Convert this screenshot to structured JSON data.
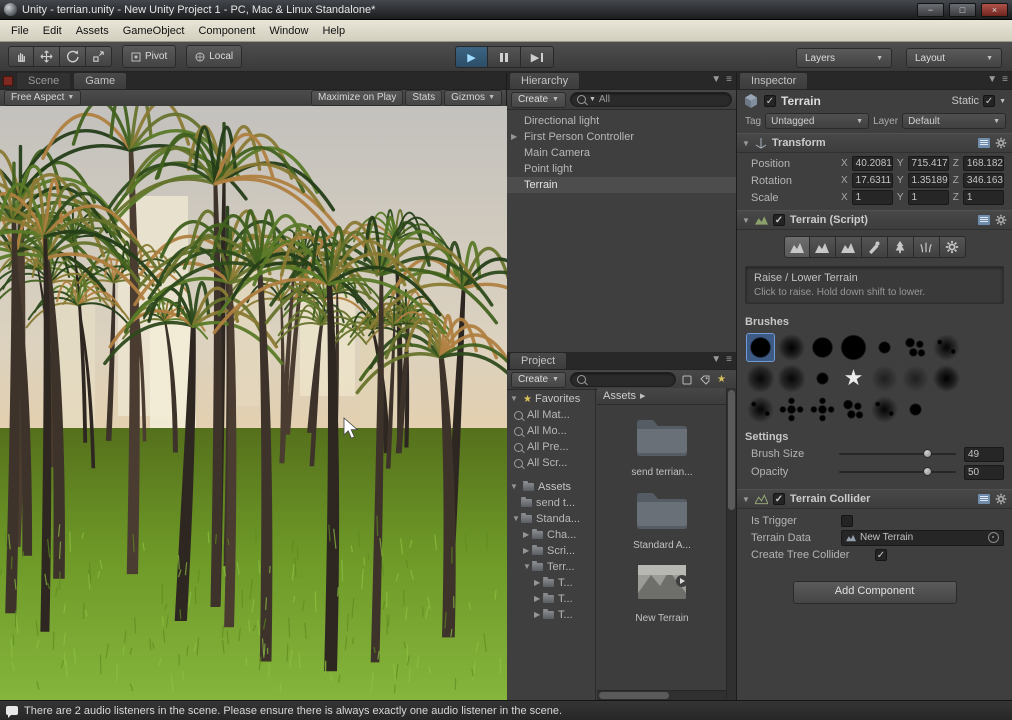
{
  "window": {
    "title": "Unity - terrian.unity - New Unity Project 1 - PC, Mac & Linux Standalone*",
    "minimize": "−",
    "maximize": "□",
    "close": "×"
  },
  "menubar": {
    "items": [
      "File",
      "Edit",
      "Assets",
      "GameObject",
      "Component",
      "Window",
      "Help"
    ]
  },
  "toolbar": {
    "pivot": "Pivot",
    "local": "Local",
    "layers": "Layers",
    "layout": "Layout"
  },
  "game_panel": {
    "scene_tab": "Scene",
    "game_tab": "Game",
    "aspect": "Free Aspect",
    "maximize_on_play": "Maximize on Play",
    "stats": "Stats",
    "gizmos": "Gizmos"
  },
  "hierarchy": {
    "tab": "Hierarchy",
    "create": "Create",
    "search_filter": "All",
    "items": [
      {
        "label": "Directional light",
        "foldable": false,
        "selected": false
      },
      {
        "label": "First Person Controller",
        "foldable": true,
        "selected": false
      },
      {
        "label": "Main Camera",
        "foldable": false,
        "selected": false
      },
      {
        "label": "Point light",
        "foldable": false,
        "selected": false
      },
      {
        "label": "Terrain",
        "foldable": false,
        "selected": true
      }
    ]
  },
  "project": {
    "tab": "Project",
    "create": "Create",
    "favorites_label": "Favorites",
    "favorites": [
      {
        "label": "All Mat..."
      },
      {
        "label": "All Mo..."
      },
      {
        "label": "All Pre..."
      },
      {
        "label": "All Scr..."
      }
    ],
    "assets_label": "Assets",
    "tree": [
      {
        "label": "send t...",
        "indent": 0,
        "fold": "none"
      },
      {
        "label": "Standa...",
        "indent": 0,
        "fold": "open"
      },
      {
        "label": "Cha...",
        "indent": 1,
        "fold": "closed"
      },
      {
        "label": "Scri...",
        "indent": 1,
        "fold": "closed"
      },
      {
        "label": "Terr...",
        "indent": 1,
        "fold": "open"
      },
      {
        "label": "T...",
        "indent": 2,
        "fold": "closed"
      },
      {
        "label": "T...",
        "indent": 2,
        "fold": "closed"
      },
      {
        "label": "T...",
        "indent": 2,
        "fold": "closed"
      }
    ],
    "breadcrumb": "Assets",
    "thumbnails": [
      {
        "label": "send terrian...",
        "kind": "folder"
      },
      {
        "label": "Standard A...",
        "kind": "folder"
      },
      {
        "label": "New Terrain",
        "kind": "terrain"
      }
    ]
  },
  "inspector": {
    "tab": "Inspector",
    "object_name": "Terrain",
    "static_label": "Static",
    "tag_label": "Tag",
    "tag_value": "Untagged",
    "layer_label": "Layer",
    "layer_value": "Default",
    "transform": {
      "title": "Transform",
      "rows": [
        {
          "label": "Position",
          "x": "40.2081",
          "y": "715.417",
          "z": "168.182"
        },
        {
          "label": "Rotation",
          "x": "17.6311",
          "y": "1.35189",
          "z": "346.163"
        },
        {
          "label": "Scale",
          "x": "1",
          "y": "1",
          "z": "1"
        }
      ]
    },
    "terrain_script": {
      "title": "Terrain (Script)",
      "tools": [
        {
          "name": "raise-lower-terrain",
          "icon": "mountain",
          "active": true
        },
        {
          "name": "paint-height",
          "icon": "mountain",
          "active": false
        },
        {
          "name": "smooth-height",
          "icon": "mountain",
          "active": false
        },
        {
          "name": "paint-texture",
          "icon": "brush",
          "active": false
        },
        {
          "name": "place-trees",
          "icon": "tree",
          "active": false
        },
        {
          "name": "paint-details",
          "icon": "grass",
          "active": false
        },
        {
          "name": "terrain-settings",
          "icon": "gear",
          "active": false
        }
      ],
      "tool_title": "Raise / Lower Terrain",
      "tool_hint": "Click to raise. Hold down shift to lower.",
      "brushes_label": "Brushes",
      "brushes": {
        "selected": 0,
        "kinds": [
          "hard",
          "soft",
          "hard",
          "big",
          "small",
          "spots",
          "spray",
          "fuzzy",
          "fuzzy",
          "small",
          "star",
          "faint",
          "faint",
          "soft",
          "spray",
          "burst",
          "burst",
          "spots",
          "spray",
          "small"
        ]
      },
      "settings_label": "Settings",
      "brush_size": {
        "label": "Brush Size",
        "value": "49"
      },
      "opacity": {
        "label": "Opacity",
        "value": "50"
      }
    },
    "terrain_collider": {
      "title": "Terrain Collider",
      "is_trigger": "Is Trigger",
      "terrain_data_label": "Terrain Data",
      "terrain_data_value": "New Terrain",
      "create_tree_collider": "Create Tree Collider"
    },
    "add_component": "Add Component"
  },
  "statusbar": {
    "message": "There are 2 audio listeners in the scene. Please ensure there is always exactly one audio listener in the scene."
  }
}
